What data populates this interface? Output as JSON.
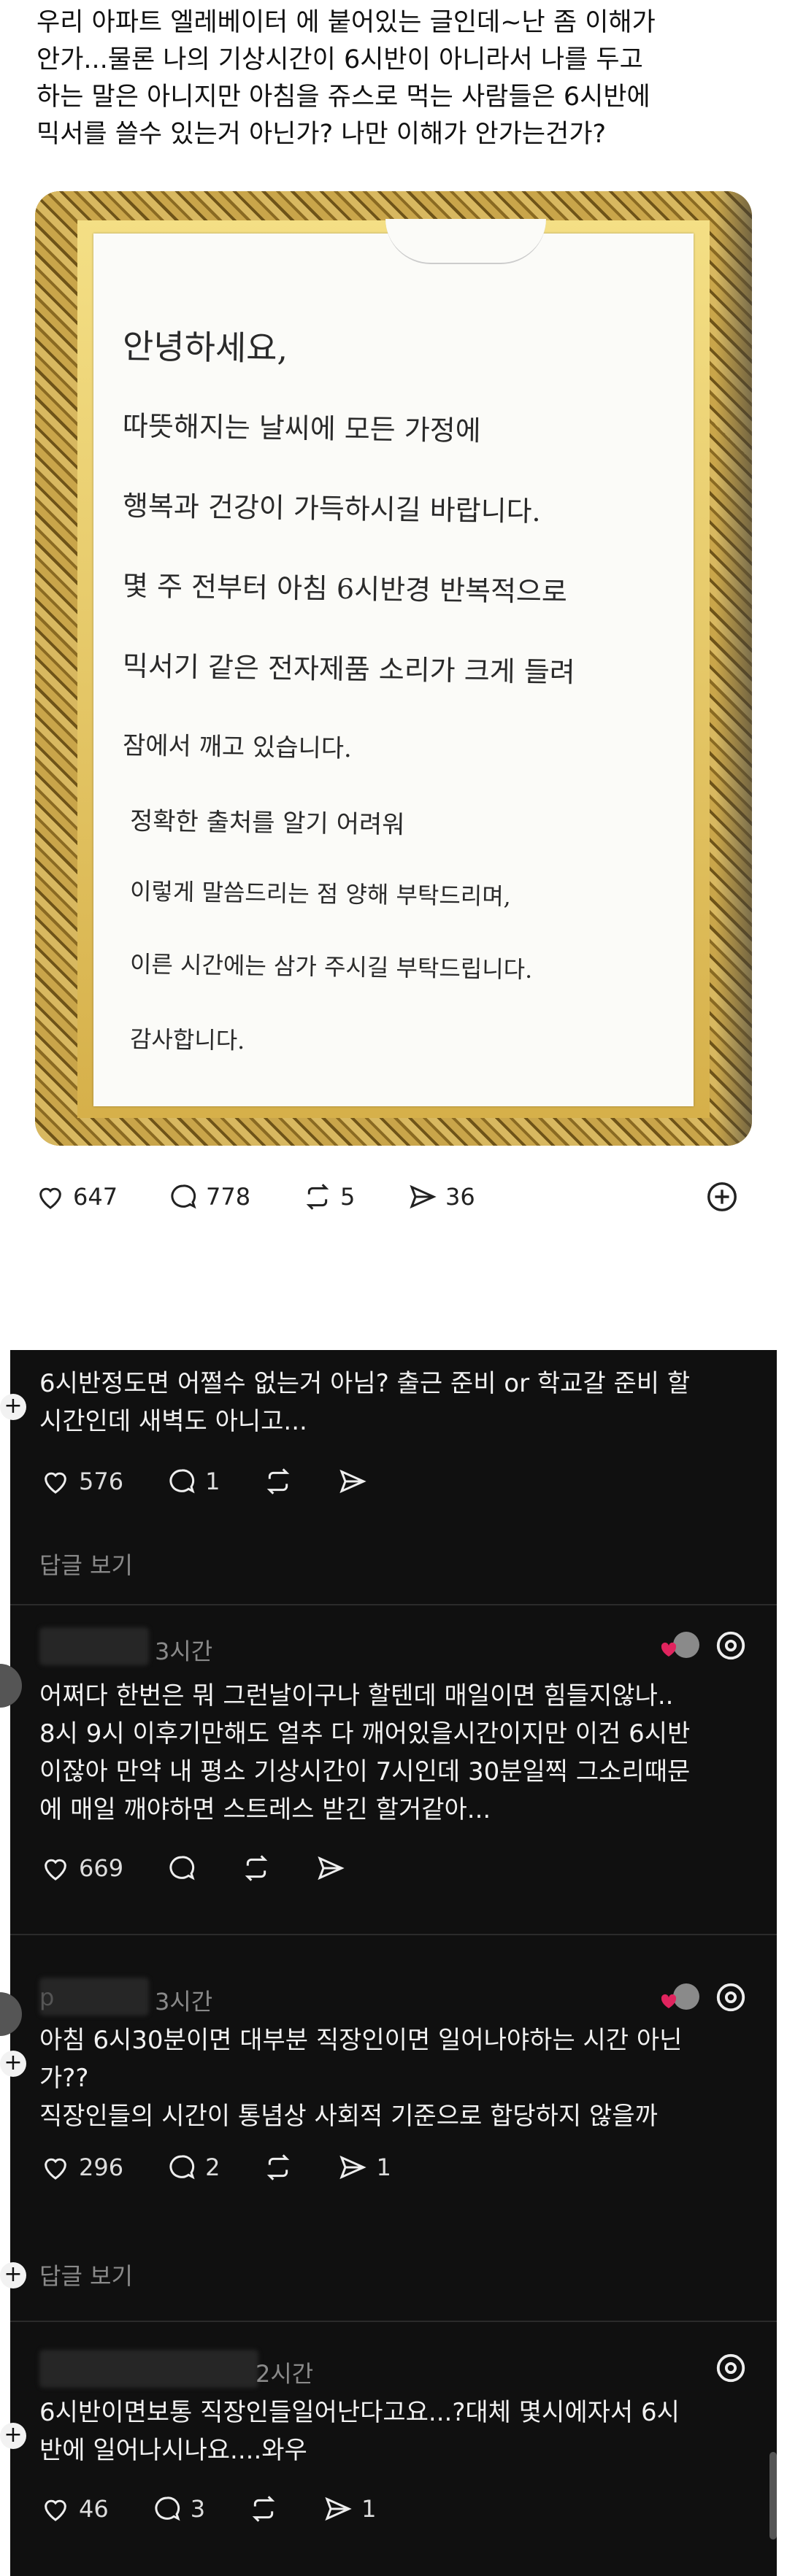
{
  "post": {
    "lines": [
      "우리 아파트 엘레베이터 에 붙어있는 글인데~난 좀 이해가",
      "안가...물론 나의 기상시간이 6시반이 아니라서 나를 두고",
      "하는 말은 아니지만 아침을 쥬스로 먹는 사람들은 6시반에",
      "믹서를 쓸수 있는거 아닌가? 나만 이해가 안가는건가?"
    ]
  },
  "notice": {
    "lines": [
      "안녕하세요,",
      "따뜻해지는 날씨에 모든 가정에",
      "행복과 건강이 가득하시길 바랍니다.",
      "몇 주 전부터 아침 6시반경 반복적으로",
      "믹서기 같은 전자제품 소리가 크게 들려",
      "잠에서 깨고 있습니다.",
      "정확한 출처를 알기 어려워",
      "이렇게 말씀드리는 점 양해 부탁드리며,",
      "이른 시간에는 삼가 주시길 부탁드립니다.",
      "감사합니다."
    ]
  },
  "post_actions": {
    "likes": "647",
    "comments": "778",
    "reposts": "5",
    "shares": "36"
  },
  "comments": [
    {
      "lines": [
        "6시반정도면 어쩔수 없는거 아님? 출근 준비 or 학교갈 준비 할",
        "시간인데 새벽도 아니고..."
      ],
      "likes": "576",
      "replies": "1",
      "reposts": "",
      "shares": ""
    },
    {
      "time": "3시간",
      "lines": [
        "어쩌다 한번은 뭐 그런날이구나 할텐데 매일이면 힘들지않나..",
        "8시 9시 이후기만해도 얼추 다 깨어있을시간이지만 이건 6시반",
        "이잖아 만약 내 평소 기상시간이 7시인데 30분일찍 그소리때문",
        "에 매일 깨야하면 스트레스 받긴 할거같아..."
      ],
      "likes": "669",
      "replies": "",
      "reposts": "",
      "shares": ""
    },
    {
      "name_initial": "p",
      "time": "3시간",
      "lines": [
        "아침 6시30분이면 대부분 직장인이면 일어나야하는 시간 아닌",
        "가??",
        "직장인들의 시간이 통념상 사회적 기준으로 합당하지 않을까"
      ],
      "likes": "296",
      "replies": "2",
      "reposts": "",
      "shares": "1"
    },
    {
      "time": "2시간",
      "lines": [
        "6시반이면보통 직장인들일어난다고요...?대체 몇시에자서 6시",
        "반에 일어나시나요....와우"
      ],
      "likes": "46",
      "replies": "3",
      "reposts": "",
      "shares": "1"
    }
  ],
  "reply_link": "답글 보기"
}
